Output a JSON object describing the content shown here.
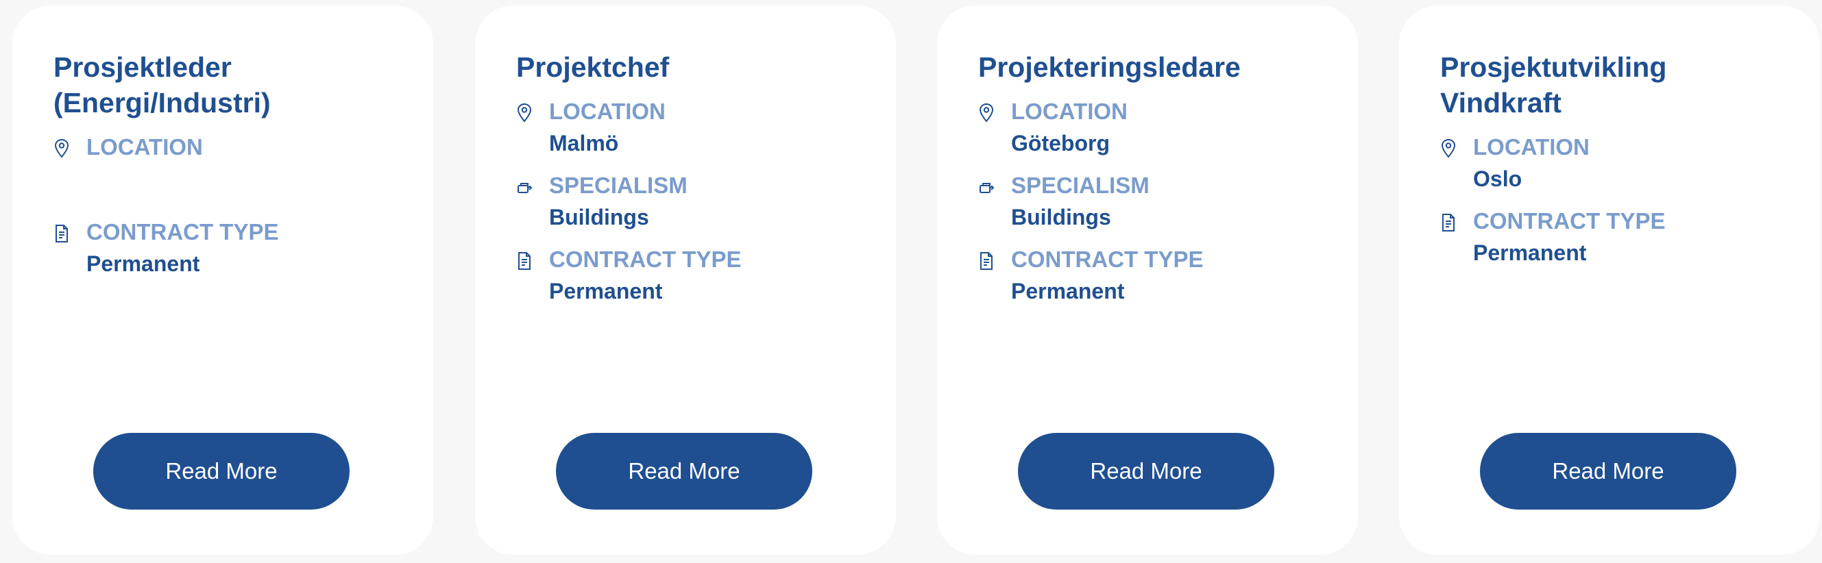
{
  "cards": [
    {
      "title": "Prosjektleder (Energi/Industri)",
      "fields": [
        {
          "icon": "location-pin-icon",
          "label": "LOCATION",
          "value": ""
        },
        {
          "icon": "document-icon",
          "label": "CONTRACT TYPE",
          "value": "Permanent"
        }
      ],
      "button": "Read More"
    },
    {
      "title": "Projektchef",
      "fields": [
        {
          "icon": "location-pin-icon",
          "label": "LOCATION",
          "value": "Malmö"
        },
        {
          "icon": "specialism-icon",
          "label": "SPECIALISM",
          "value": "Buildings"
        },
        {
          "icon": "document-icon",
          "label": "CONTRACT TYPE",
          "value": "Permanent"
        }
      ],
      "button": "Read More"
    },
    {
      "title": "Projekteringsledare",
      "fields": [
        {
          "icon": "location-pin-icon",
          "label": "LOCATION",
          "value": "Göteborg"
        },
        {
          "icon": "specialism-icon",
          "label": "SPECIALISM",
          "value": "Buildings"
        },
        {
          "icon": "document-icon",
          "label": "CONTRACT TYPE",
          "value": "Permanent"
        }
      ],
      "button": "Read More"
    },
    {
      "title": "Prosjektutvikling Vindkraft",
      "fields": [
        {
          "icon": "location-pin-icon",
          "label": "LOCATION",
          "value": "Oslo"
        },
        {
          "icon": "document-icon",
          "label": "CONTRACT TYPE",
          "value": "Permanent"
        }
      ],
      "button": "Read More"
    }
  ],
  "colors": {
    "primary": "#1f4f91",
    "label": "#7a9ccc",
    "card_bg": "#ffffff",
    "page_bg": "#f7f7f7"
  }
}
